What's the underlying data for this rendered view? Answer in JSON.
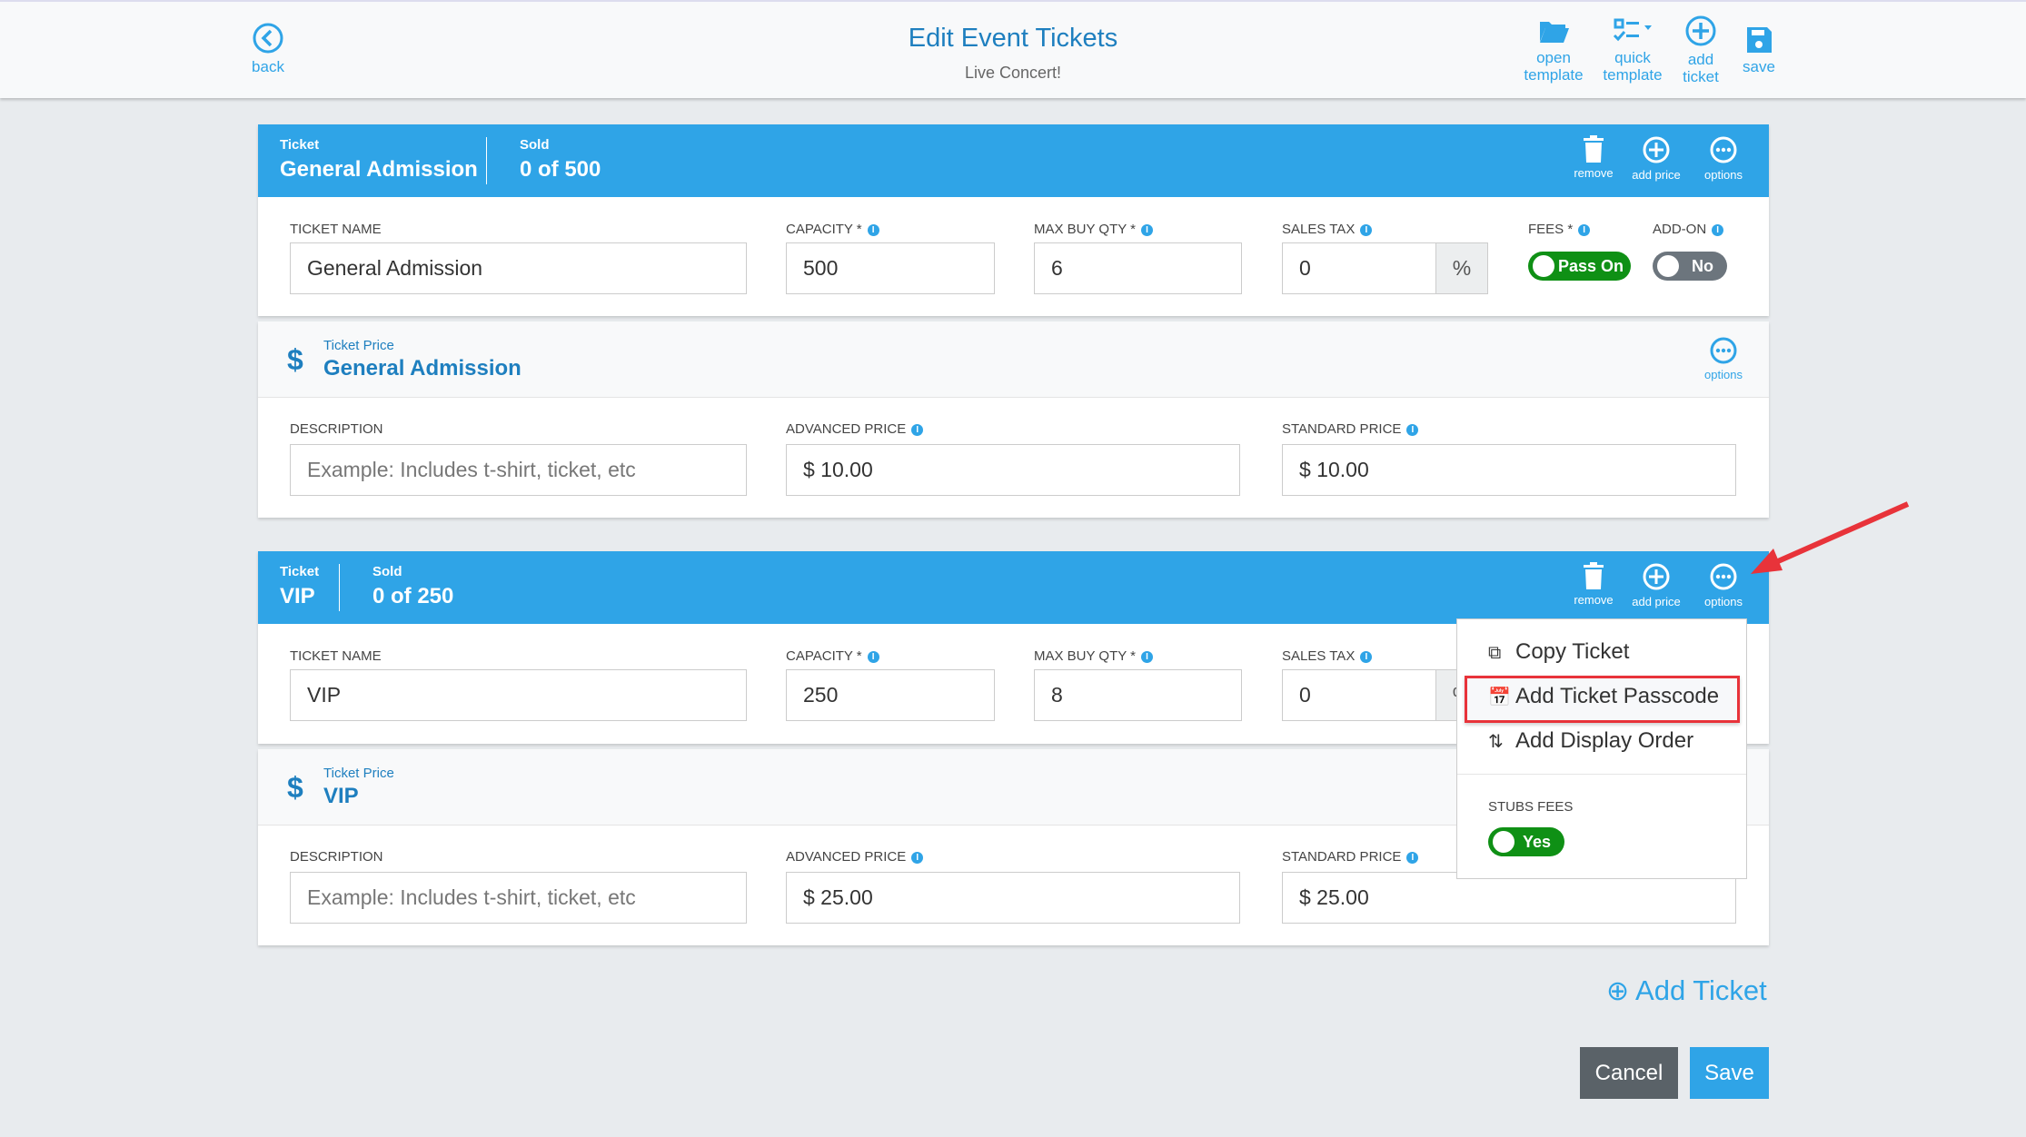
{
  "header": {
    "title": "Edit Event Tickets",
    "subtitle": "Live Concert!",
    "back": "back",
    "toolbar": [
      {
        "l1": "open",
        "l2": "template",
        "icon": "folder-open-icon"
      },
      {
        "l1": "quick",
        "l2": "template",
        "icon": "checklist-icon"
      },
      {
        "l1": "add",
        "l2": "ticket",
        "icon": "plus-circle-icon"
      },
      {
        "l1": "",
        "l2": "save",
        "icon": "floppy-icon"
      }
    ]
  },
  "actions": {
    "remove": "remove",
    "add_price": "add price",
    "options": "options"
  },
  "labels": {
    "ticket": "Ticket",
    "sold": "Sold",
    "ticket_name": "TICKET NAME",
    "capacity": "CAPACITY *",
    "max_buy": "MAX BUY QTY *",
    "sales_tax": "SALES TAX",
    "fees": "FEES *",
    "addon": "ADD-ON",
    "ticket_price": "Ticket Price",
    "description": "DESCRIPTION",
    "advanced_price": "ADVANCED PRICE",
    "standard_price": "STANDARD PRICE",
    "percent": "%",
    "desc_placeholder": "Example: Includes t-shirt, ticket, etc"
  },
  "tickets": [
    {
      "name": "General Admission",
      "sold": "0 of 500",
      "capacity": "500",
      "max_buy": "6",
      "sales_tax": "0",
      "fees": "Pass On",
      "addon": "No",
      "price_name": "General Admission",
      "advanced": "$ 10.00",
      "standard": "$ 10.00"
    },
    {
      "name": "VIP",
      "sold": "0 of 250",
      "capacity": "250",
      "max_buy": "8",
      "sales_tax": "0",
      "price_name": "VIP",
      "advanced": "$ 25.00",
      "standard": "$ 25.00"
    }
  ],
  "menu": {
    "items": [
      "Copy Ticket",
      "Add Ticket Passcode",
      "Add Display Order"
    ],
    "stubs_fees_label": "STUBS FEES",
    "stubs_fees": "Yes",
    "highlighted": "Add Ticket Passcode"
  },
  "footer": {
    "add_ticket": "Add Ticket",
    "cancel": "Cancel",
    "save": "Save"
  },
  "colors": {
    "primary": "#2fa4e7",
    "toggle_on": "#0f9015",
    "toggle_off": "#6c757d",
    "highlight": "#e8333a"
  }
}
